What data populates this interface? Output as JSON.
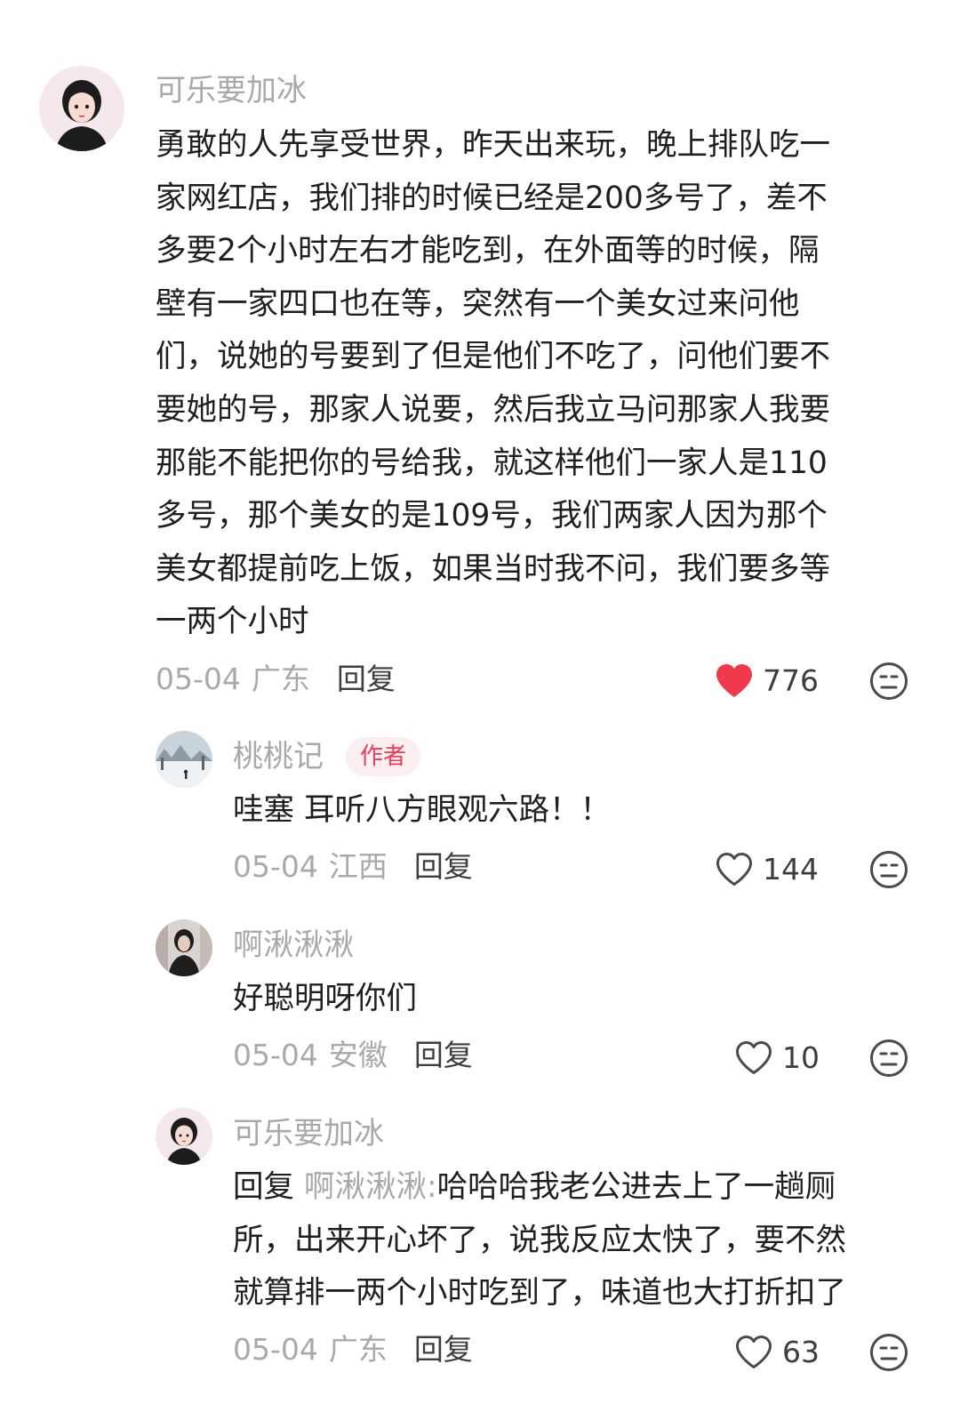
{
  "colors": {
    "username": "#a8a8ad",
    "body_text": "#1f1f1f",
    "like_active": "#f03a4c",
    "author_badge_bg": "#fdeef0",
    "author_badge_text": "#ee3b55"
  },
  "comments": [
    {
      "username": "可乐要加冰",
      "avatar_icon": "girl-portrait-avatar",
      "lines": [
        "勇敢的人先享受世界，昨天出来玩，晚上排队吃一",
        "家网红店，我们排的时候已经是200多号了，差不",
        "多要2个小时左右才能吃到，在外面等的时候，隔",
        "壁有一家四口也在等，突然有一个美女过来问他",
        "们，说她的号要到了但是他们不吃了，问他们要不",
        "要她的号，那家人说要，然后我立马问那家人我要",
        "那能不能把你的号给我，就这样他们一家人是110",
        "多号，那个美女的是109号，我们两家人因为那个",
        "美女都提前吃上饭，如果当时我不问，我们要多等",
        "一两个小时"
      ],
      "date": "05-04",
      "location": "广东",
      "reply_label": "回复",
      "likes": "776",
      "liked": true
    },
    {
      "username": "桃桃记",
      "badge": "作者",
      "avatar_icon": "snow-landscape-avatar",
      "lines": [
        "哇塞 耳听八方眼观六路！！"
      ],
      "date": "05-04",
      "location": "江西",
      "reply_label": "回复",
      "likes": "144",
      "liked": false
    },
    {
      "username": "啊湫湫湫",
      "avatar_icon": "person-dark-avatar",
      "lines": [
        "好聪明呀你们"
      ],
      "date": "05-04",
      "location": "安徽",
      "reply_label": "回复",
      "likes": "10",
      "liked": false
    },
    {
      "username": "可乐要加冰",
      "avatar_icon": "girl-portrait-avatar",
      "reply_prefix": "回复",
      "reply_target": "啊湫湫湫:",
      "lines": [
        "哈哈哈我老公进去上了一趟厕",
        "所，出来开心坏了，说我反应太快了，要不然",
        "就算排一两个小时吃到了，味道也大打折扣了"
      ],
      "date": "05-04",
      "location": "广东",
      "reply_label": "回复",
      "likes": "63",
      "liked": false
    }
  ]
}
